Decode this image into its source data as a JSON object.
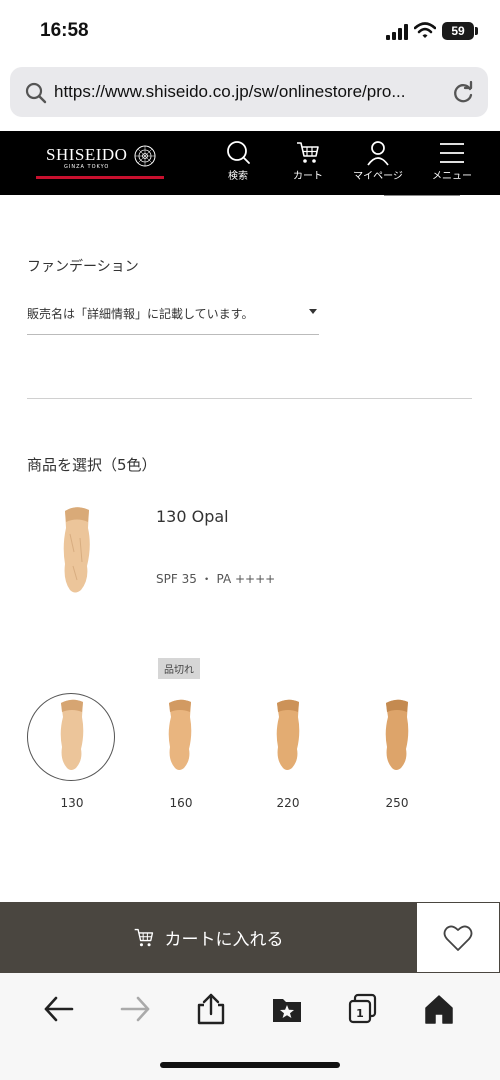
{
  "status_bar": {
    "time": "16:58",
    "battery": "59"
  },
  "browser": {
    "url": "https://www.shiseido.co.jp/sw/onlinestore/pro..."
  },
  "header": {
    "logo": "SHISEIDO",
    "logo_sub": "GINZA TOKYO",
    "nav": [
      {
        "label": "検索",
        "icon": "search-icon"
      },
      {
        "label": "カート",
        "icon": "cart-icon"
      },
      {
        "label": "マイページ",
        "icon": "user-icon"
      },
      {
        "label": "メニュー",
        "icon": "menu-icon"
      }
    ]
  },
  "product": {
    "category": "ファンデーション",
    "sales_name_select": "販売名は「詳細情報」に記載しています。",
    "choose_title": "商品を選択（5色）",
    "selected_name": "130 Opal",
    "spec": "SPF 35 ・ PA ++++",
    "soldout_badge": "品切れ",
    "shades": [
      {
        "label": "130",
        "color": "#ecc59a",
        "selected": true
      },
      {
        "label": "160",
        "color": "#e9b57f"
      },
      {
        "label": "220",
        "color": "#e3ac72"
      },
      {
        "label": "250",
        "color": "#dda46a"
      }
    ]
  },
  "actions": {
    "add_to_cart": "カートに入れる"
  },
  "toolbar": {
    "icons": [
      "back-icon",
      "forward-icon",
      "share-icon",
      "bookmarks-icon",
      "tabs-icon",
      "home-icon"
    ],
    "tab_count": "1"
  }
}
